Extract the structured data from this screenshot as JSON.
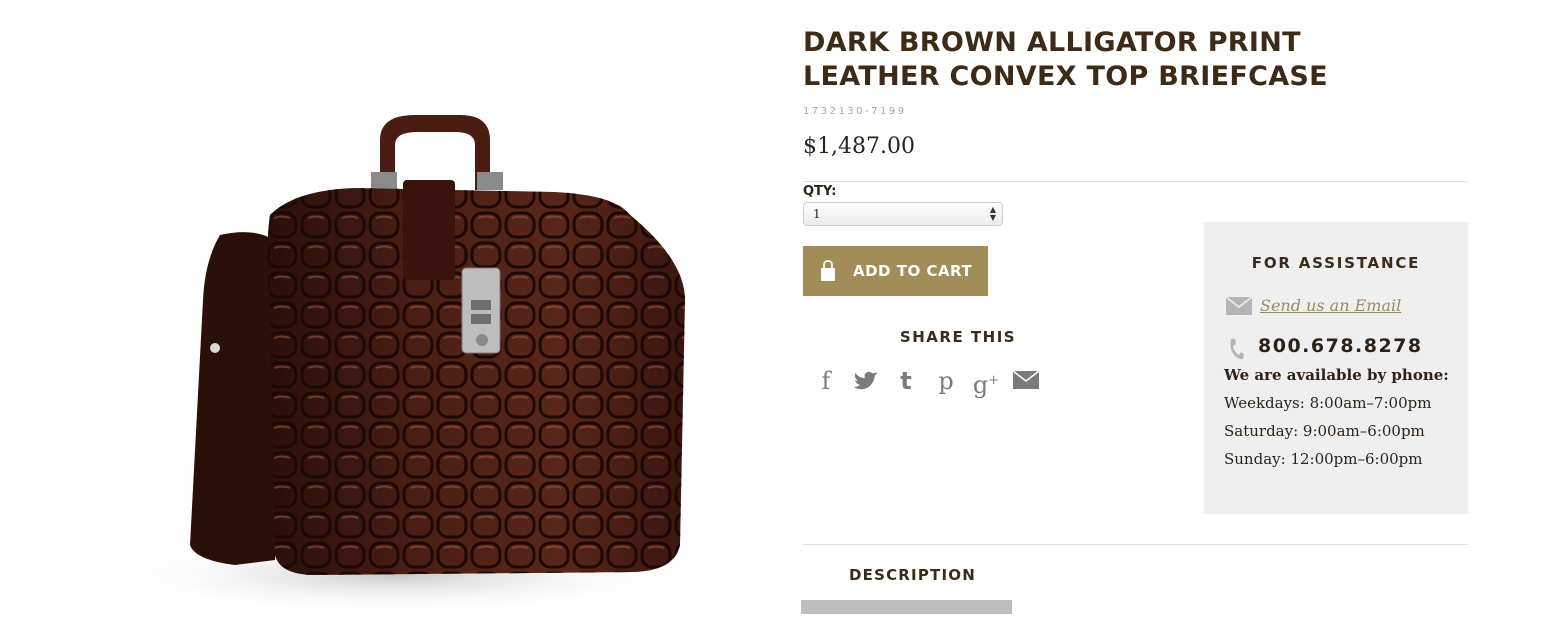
{
  "product": {
    "title": "DARK BROWN ALLIGATOR PRINT LEATHER CONVEX TOP BRIEFCASE",
    "sku": "1732130-7199",
    "price": "$1,487.00",
    "image_alt": "Dark brown alligator print leather briefcase",
    "brand_color": "#a28c57"
  },
  "purchase": {
    "qty_label": "QTY:",
    "qty_value": "1",
    "add_to_cart_label": "ADD TO CART"
  },
  "share": {
    "title": "SHARE THIS",
    "icons": [
      "facebook-icon",
      "twitter-icon",
      "tumblr-icon",
      "pinterest-icon",
      "google-plus-icon",
      "email-icon"
    ]
  },
  "assistance": {
    "title": "FOR ASSISTANCE",
    "email_link": "Send us an Email",
    "phone": "800.678.8278",
    "hours_title": "We are available by phone:",
    "hours": [
      "Weekdays: 8:00am–7:00pm",
      "Saturday: 9:00am–6:00pm",
      "Sunday: 12:00pm–6:00pm"
    ]
  },
  "tabs": {
    "description": "DESCRIPTION"
  }
}
